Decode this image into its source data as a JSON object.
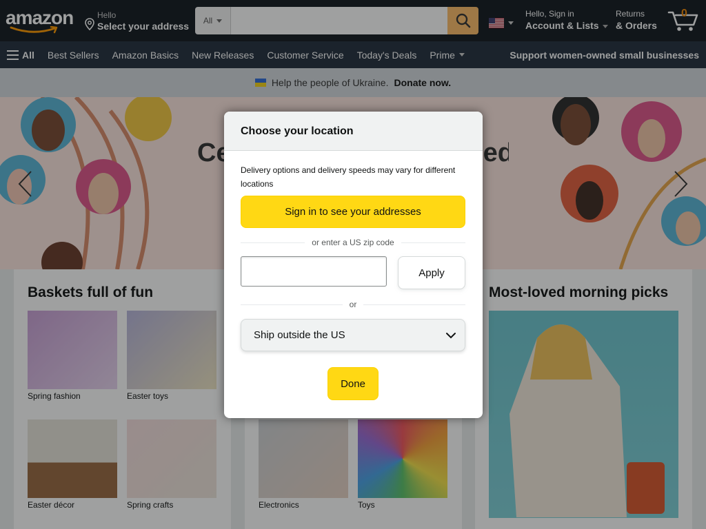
{
  "header": {
    "logo_text": "amazon",
    "address": {
      "greeting": "Hello",
      "label": "Select your address"
    },
    "search": {
      "category": "All",
      "placeholder": ""
    },
    "account": {
      "greeting": "Hello, Sign in",
      "label": "Account & Lists"
    },
    "returns": {
      "line1": "Returns",
      "line2": "& Orders"
    },
    "cart": {
      "count": "0"
    }
  },
  "nav": {
    "all_label": "All",
    "items": [
      "Best Sellers",
      "Amazon Basics",
      "New Releases",
      "Customer Service",
      "Today's Deals"
    ],
    "prime_label": "Prime",
    "promo": "Support women-owned small businesses"
  },
  "banner": {
    "text": "Help the people of Ukraine.",
    "link": "Donate now."
  },
  "hero": {
    "title_left": "Ce",
    "title_right": "ed"
  },
  "cards": [
    {
      "title": "Baskets full of fun",
      "tiles": [
        "Spring fashion",
        "Easter toys",
        "Easter décor",
        "Spring crafts"
      ]
    },
    {
      "title": "",
      "tiles": [
        "Electronics",
        "Toys"
      ]
    },
    {
      "title": "Most-loved morning picks",
      "tiles": []
    }
  ],
  "modal": {
    "title": "Choose your location",
    "description": "Delivery options and delivery speeds may vary for different locations",
    "signin_button": "Sign in to see your addresses",
    "zip_separator": "or enter a US zip code",
    "zip_value": "",
    "apply_button": "Apply",
    "or_separator": "or",
    "ship_select": "Ship outside the US",
    "done_button": "Done"
  },
  "colors": {
    "header_bg": "#131921",
    "nav_bg": "#232f3e",
    "search_button": "#febd69",
    "primary_button": "#ffd814",
    "cart_count": "#f08804"
  }
}
